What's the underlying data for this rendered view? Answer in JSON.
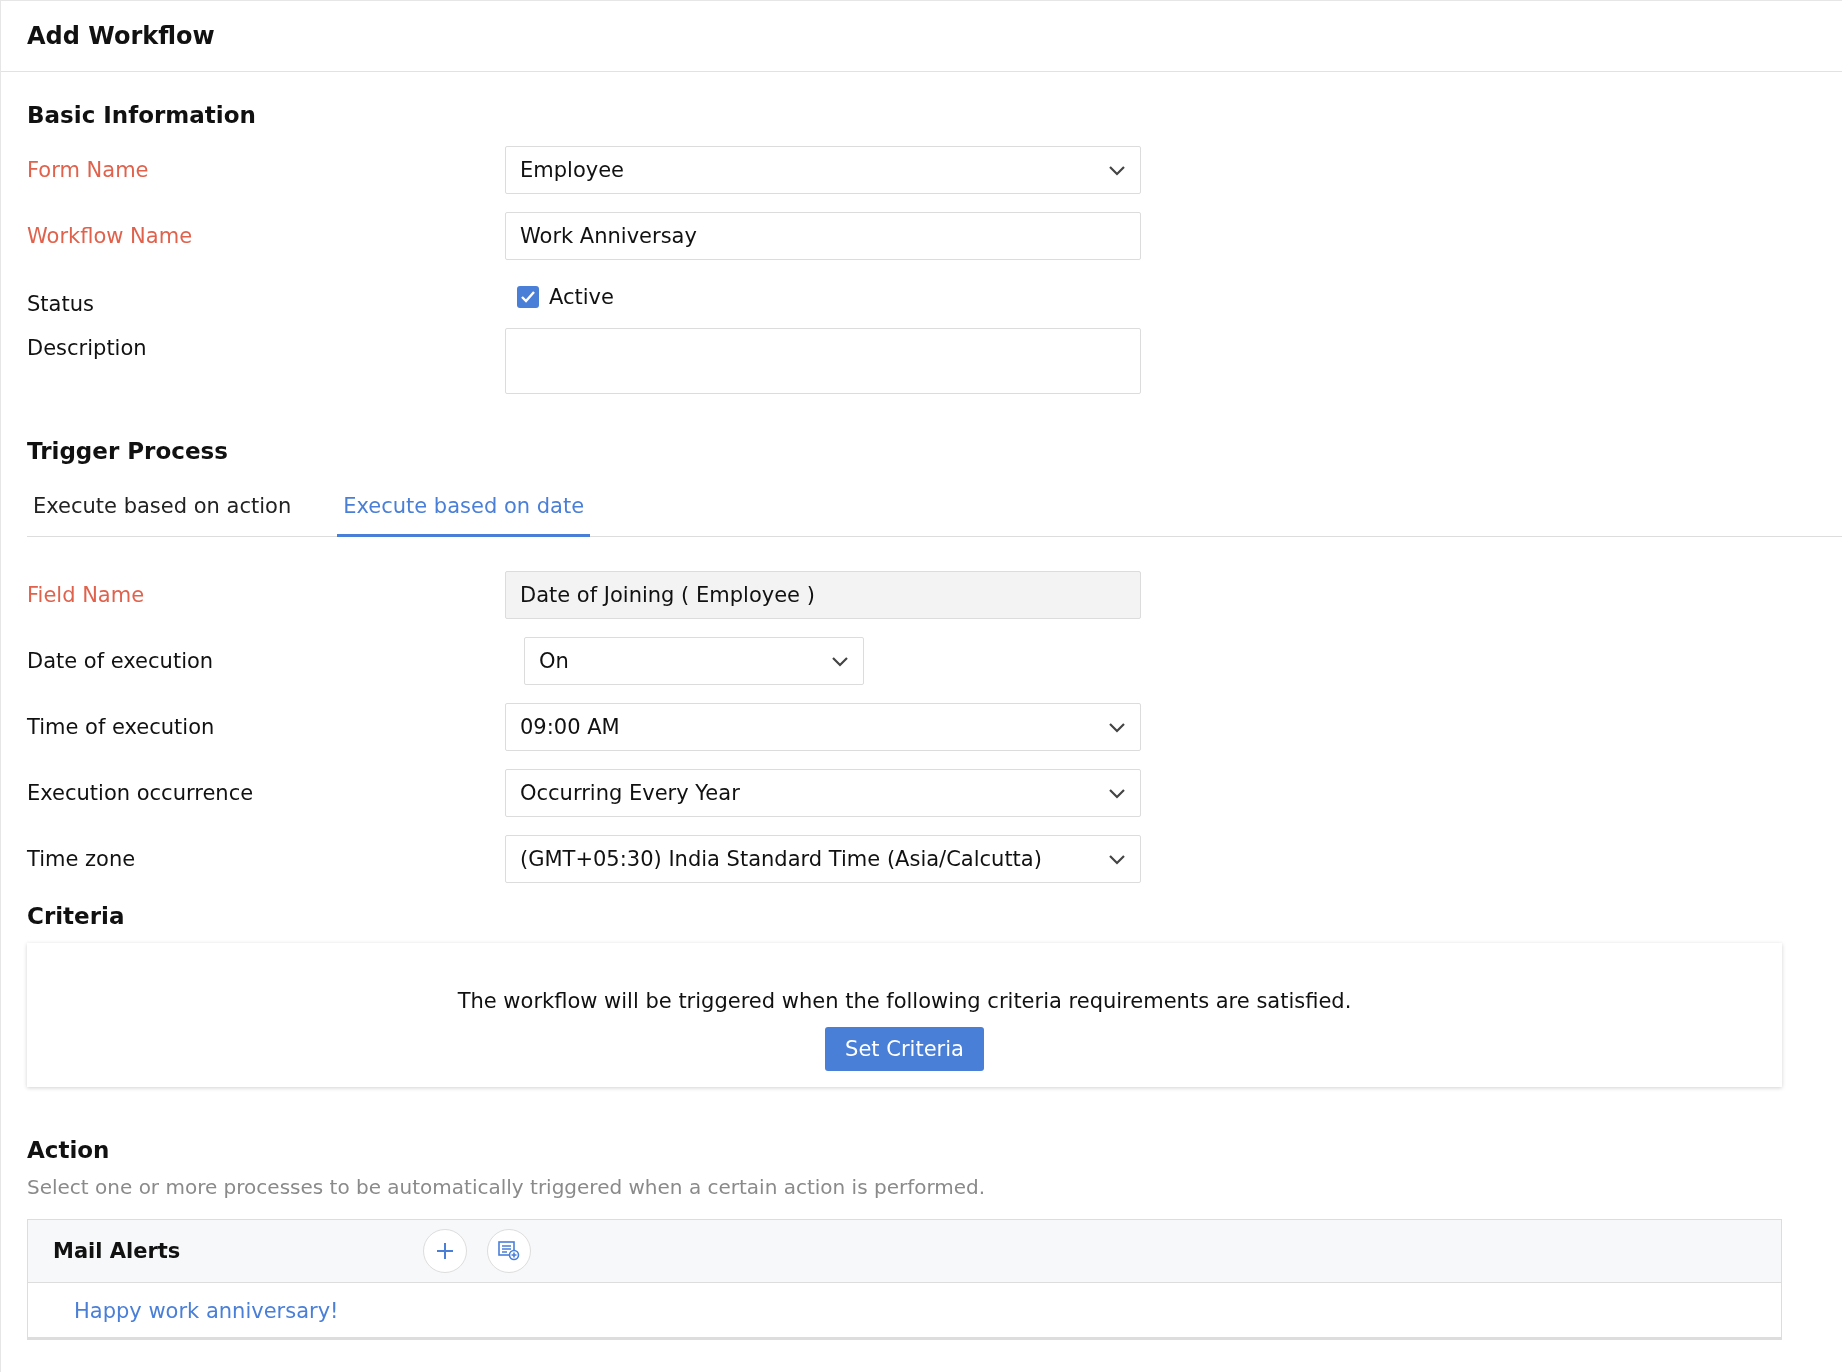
{
  "header": {
    "title": "Add Workflow"
  },
  "basic": {
    "heading": "Basic Information",
    "fields": [
      {
        "kind": "select",
        "label": "Form Name",
        "required": true,
        "value": "Employee"
      },
      {
        "kind": "text",
        "label": "Workflow Name",
        "required": true,
        "value": "Work Anniversay"
      },
      {
        "kind": "checkbox",
        "label": "Status",
        "required": false,
        "value": "Active",
        "checked": true
      },
      {
        "kind": "textarea",
        "label": "Description",
        "required": false
      }
    ]
  },
  "trigger": {
    "heading": "Trigger Process",
    "tabs": [
      {
        "label": "Execute based on action",
        "selected": false
      },
      {
        "label": "Execute based on date",
        "selected": true
      }
    ],
    "fields": [
      {
        "kind": "readonly",
        "label": "Field Name",
        "required": true,
        "value": "Date of Joining ( Employee )"
      },
      {
        "kind": "select_small",
        "label": "Date of execution",
        "required": false,
        "value": "On"
      },
      {
        "kind": "select",
        "label": "Time of execution",
        "required": false,
        "value": "09:00 AM"
      },
      {
        "kind": "select",
        "label": "Execution occurrence",
        "required": false,
        "value": "Occurring Every Year"
      },
      {
        "kind": "select",
        "label": "Time zone",
        "required": false,
        "value": "(GMT+05:30) India Standard Time (Asia/Calcutta)"
      }
    ]
  },
  "criteria": {
    "heading": "Criteria",
    "message": "The workflow will be triggered when the following criteria requirements are satisfied.",
    "button": "Set Criteria"
  },
  "action": {
    "heading": "Action",
    "description": "Select one or more processes to be automatically triggered when a certain action is performed.",
    "panels": [
      {
        "title": "Mail Alerts",
        "items": [
          "Happy work anniversary!"
        ]
      }
    ]
  }
}
